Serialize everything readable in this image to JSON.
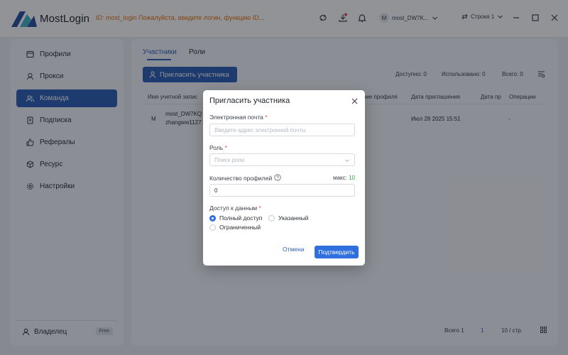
{
  "app": {
    "name": "MostLogin",
    "banner": "ID: most_login Пожалуйста, введите логин, функцию ID..."
  },
  "header": {
    "user_avatar": "M",
    "user_name": "most_DW7K...",
    "line_label": "Строка 1"
  },
  "sidebar": {
    "items": [
      {
        "label": "Профили"
      },
      {
        "label": "Прокси"
      },
      {
        "label": "Команда"
      },
      {
        "label": "Подписка"
      },
      {
        "label": "Рефералы"
      },
      {
        "label": "Ресурс"
      },
      {
        "label": "Настройки"
      }
    ],
    "owner_label": "Владелец",
    "owner_badge": "Free"
  },
  "main": {
    "tabs": [
      {
        "label": "Участники"
      },
      {
        "label": "Роли"
      }
    ],
    "invite_button": "Пригласить участника",
    "stats": {
      "available": "Доступно: 0",
      "used": "Использовано: 0",
      "total": "Всего: 0"
    },
    "columns": [
      "Имя учетной запис",
      "ние профиля",
      "Дата приглашения",
      "Дата пр",
      "Операции"
    ],
    "rows": [
      {
        "avatar": "M",
        "name": "most_DW7KQ",
        "email": "zhangww1127",
        "invite_date": "Июл 28 2025 15:51",
        "ops": "-"
      }
    ],
    "pager": {
      "total": "Всего 1",
      "page": "1",
      "per_page": "10 / стр."
    }
  },
  "modal": {
    "title": "Пригласить участника",
    "email_label": "Электронная почта",
    "email_placeholder": "Введите адрес электронной почты",
    "role_label": "Роль",
    "role_placeholder": "Поиск роли",
    "profiles_label": "Количество профилей",
    "max_label": "макс:",
    "max_value": "10",
    "profiles_value": "0",
    "access_label": "Доступ к данным",
    "access_options": [
      {
        "label": "Полный доступ",
        "checked": true
      },
      {
        "label": "Указанный",
        "checked": false
      },
      {
        "label": "Ограниченный",
        "checked": false
      }
    ],
    "cancel": "Отмена",
    "confirm": "Подтвердить"
  },
  "colors": {
    "accent": "#2f5fb9",
    "primary_button": "#2f6fe0",
    "banner_text": "#e8710a",
    "max_value": "#2ea043",
    "required": "#e5484d"
  }
}
